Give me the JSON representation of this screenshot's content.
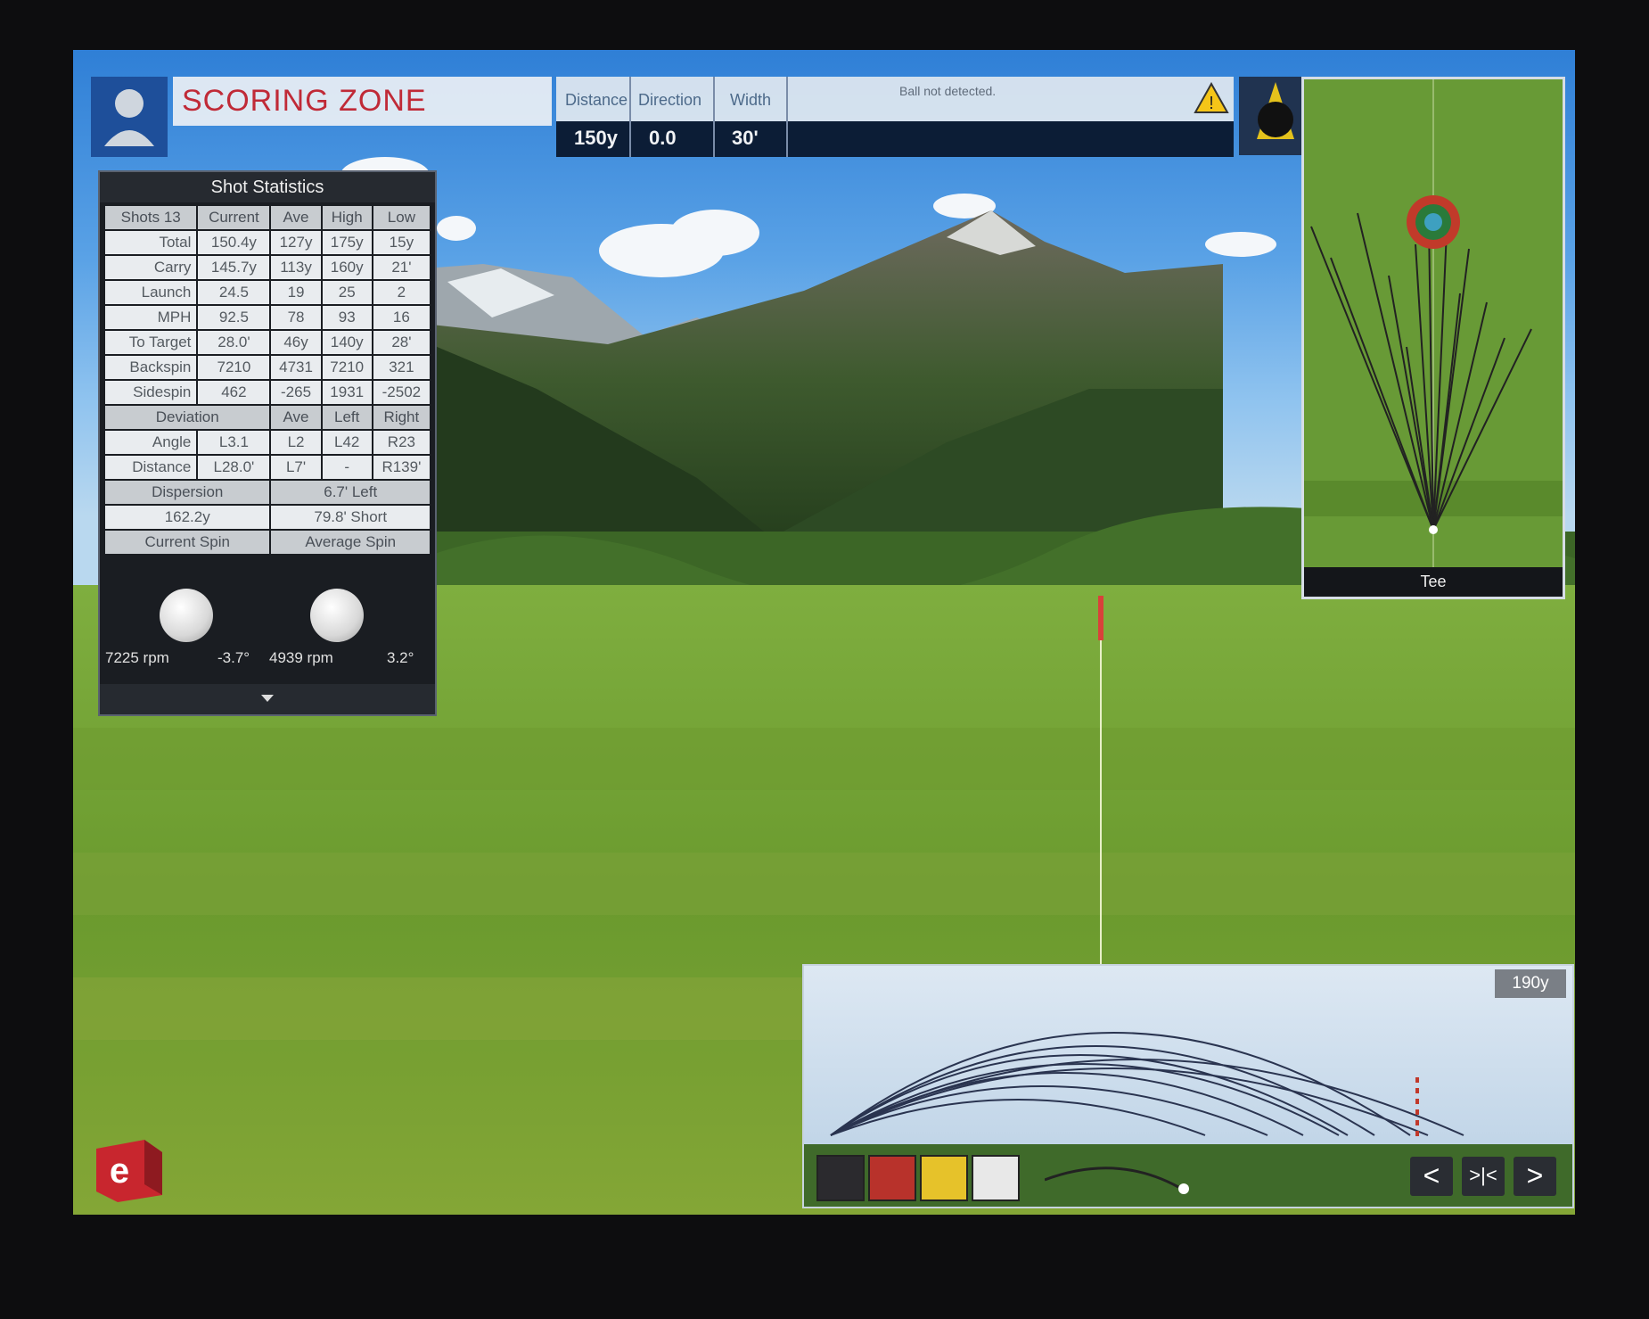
{
  "header": {
    "title": "SCORING ZONE",
    "distance_label": "Distance",
    "direction_label": "Direction",
    "width_label": "Width",
    "distance_value": "150y",
    "direction_value": "0.0",
    "width_value": "30'",
    "message": "Ball not detected.",
    "warning_icon": "warning-icon",
    "target_icon": "target-icon",
    "avatar_icon": "golfer-avatar-icon"
  },
  "stats": {
    "title": "Shot Statistics",
    "headers": [
      "Shots 13",
      "Current",
      "Ave",
      "High",
      "Low"
    ],
    "rows": [
      {
        "label": "Total",
        "values": [
          "150.4y",
          "127y",
          "175y",
          "15y"
        ]
      },
      {
        "label": "Carry",
        "values": [
          "145.7y",
          "113y",
          "160y",
          "21'"
        ]
      },
      {
        "label": "Launch",
        "values": [
          "24.5",
          "19",
          "25",
          "2"
        ]
      },
      {
        "label": "MPH",
        "values": [
          "92.5",
          "78",
          "93",
          "16"
        ]
      },
      {
        "label": "To Target",
        "values": [
          "28.0'",
          "46y",
          "140y",
          "28'"
        ]
      },
      {
        "label": "Backspin",
        "values": [
          "7210",
          "4731",
          "7210",
          "321"
        ]
      },
      {
        "label": "Sidespin",
        "values": [
          "462",
          "-265",
          "1931",
          "-2502"
        ]
      }
    ],
    "deviation_headers": [
      "Deviation",
      "Ave",
      "Left",
      "Right"
    ],
    "deviation_rows": [
      {
        "label": "Angle",
        "values": [
          "L3.1",
          "L2",
          "L42",
          "R23"
        ]
      },
      {
        "label": "Distance",
        "values": [
          "L28.0'",
          "L7'",
          "-",
          "R139'"
        ]
      }
    ],
    "dispersion_label": "Dispersion",
    "dispersion_dir": "6.7'  Left",
    "dispersion_dist": "162.2y",
    "dispersion_short": "79.8'  Short",
    "current_spin_label": "Current Spin",
    "average_spin_label": "Average Spin",
    "current_rpm": "7225 rpm",
    "current_axis": "-3.7°",
    "average_rpm": "4939 rpm",
    "average_axis": "3.2°"
  },
  "minimap": {
    "label": "Tee"
  },
  "trajectory": {
    "distance_label": "190y",
    "swatch_colors": [
      "#2b2a2e",
      "#b8322b",
      "#e6c22a",
      "#e8e8e8"
    ],
    "prev_label": "<",
    "fit_label": ">|<",
    "next_label": ">"
  },
  "colors": {
    "accent": "#c02a37",
    "header_bg": "#0c1d36",
    "panel_bg": "#1a1d22"
  }
}
